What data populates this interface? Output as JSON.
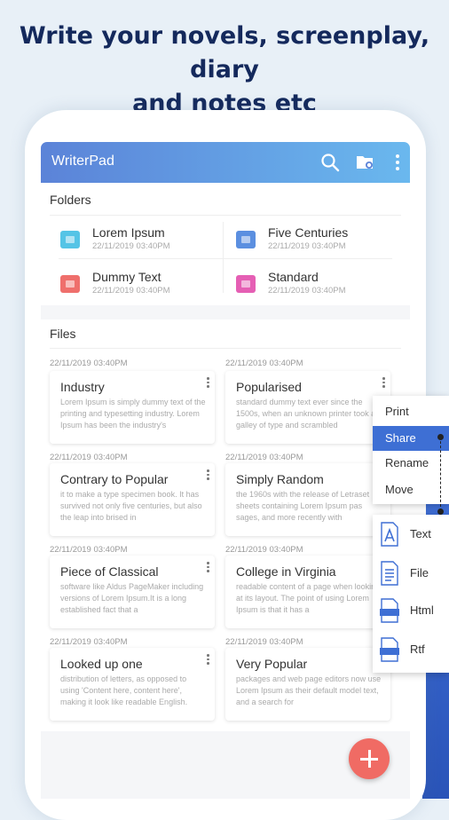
{
  "headline": {
    "line1": "Write your novels, screenplay, diary",
    "line2": "and notes etc"
  },
  "appbar": {
    "title": "WriterPad",
    "icons": [
      "search-icon",
      "folder-settings-icon",
      "more-vert-icon"
    ]
  },
  "folders": {
    "title": "Folders",
    "items": [
      {
        "name": "Lorem Ipsum",
        "date": "22/11/2019   03:40PM",
        "color": "#55c4e6"
      },
      {
        "name": "Five Centuries",
        "date": "22/11/2019   03:40PM",
        "color": "#5b8fe0"
      },
      {
        "name": "Dummy Text",
        "date": "22/11/2019   03:40PM",
        "color": "#ef6f6c"
      },
      {
        "name": "Standard",
        "date": "22/11/2019   03:40PM",
        "color": "#e55fb4"
      }
    ]
  },
  "files": {
    "title": "Files",
    "header_dates": [
      "22/11/2019   03:40PM",
      "22/11/2019   03:40PM"
    ],
    "items": [
      {
        "title": "Industry",
        "body": "Lorem Ipsum is simply dummy text of the printing and typesetting industry. Lorem Ipsum has been the industry's",
        "date_below": "22/11/2019   03:40PM"
      },
      {
        "title": "Popularised",
        "body": "standard dummy text ever since the 1500s, when an unknown printer took a galley of type and scrambled",
        "date_below": "22/11/2019   03:40PM"
      },
      {
        "title": "Contrary to Popular",
        "body": "it to make a type specimen book. It has survived not only five centuries, but also the leap into brised in",
        "date_below": "22/11/2019   03:40PM"
      },
      {
        "title": "Simply Random",
        "body": "the 1960s with the release of Letraset sheets containing Lorem Ipsum pas sages, and more recently with",
        "date_below": "22/11/2019   03:40PM"
      },
      {
        "title": "Piece of Classical",
        "body": "software like Aldus PageMaker including versions of Lorem Ipsum.It is a long established fact that a",
        "date_below": "22/11/2019   03:40PM"
      },
      {
        "title": "College in Virginia",
        "body": "readable content of a page when looking at its layout. The point of using Lorem Ipsum is that it has a",
        "date_below": "22/11/2019   03:40PM"
      },
      {
        "title": "Looked up one",
        "body": "distribution of letters, as opposed to using 'Content here, content here', making it look like readable English.",
        "date_below": ""
      },
      {
        "title": "Very Popular",
        "body": "packages and web page editors now use Lorem Ipsum as their default model text, and a search for",
        "date_below": ""
      }
    ]
  },
  "context_menu": {
    "items": [
      "Print",
      "Share",
      "Rename",
      "Move"
    ],
    "active": "Share"
  },
  "share_submenu": {
    "items": [
      {
        "label": "Text",
        "icon": "text-file-icon"
      },
      {
        "label": "File",
        "icon": "document-file-icon"
      },
      {
        "label": "Html",
        "icon": "html-file-icon"
      },
      {
        "label": "Rtf",
        "icon": "rtf-file-icon"
      }
    ]
  },
  "fab": {
    "icon": "add-icon"
  },
  "colors": {
    "accent": "#3e6fd4",
    "headline": "#14295c",
    "fab": "#f06b64"
  }
}
